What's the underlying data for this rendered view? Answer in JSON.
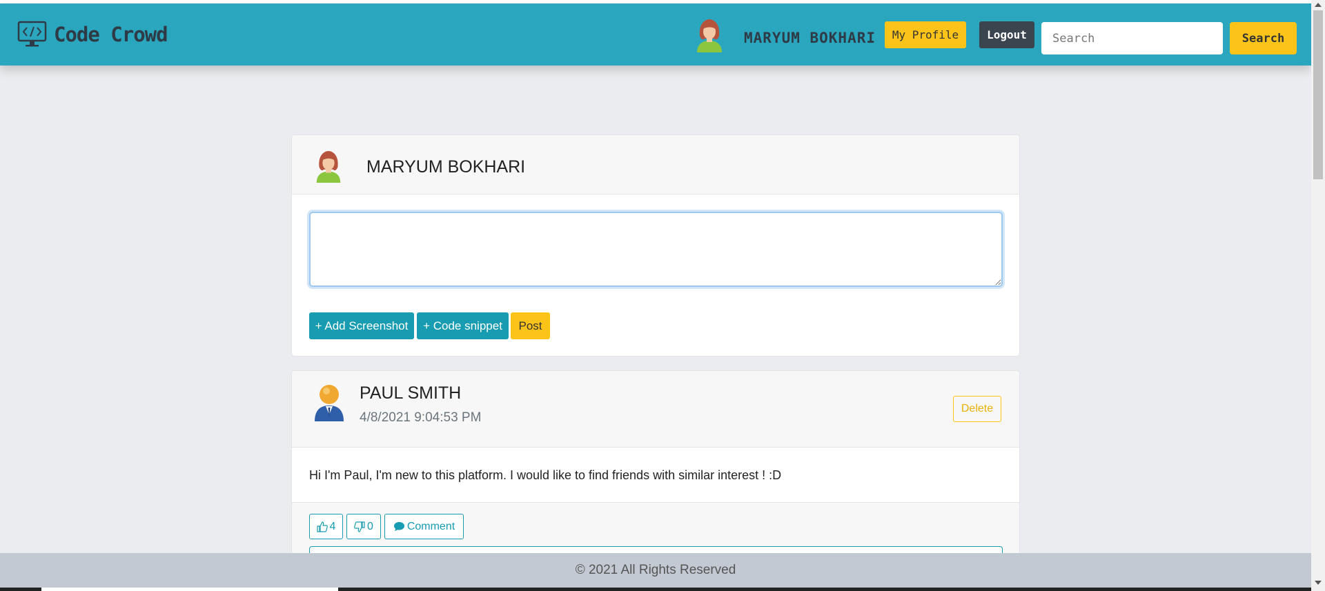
{
  "navbar": {
    "brand": "Code Crowd",
    "username": "MARYUM BOKHARI",
    "my_profile_label": "My Profile",
    "logout_label": "Logout",
    "search_placeholder": "Search",
    "search_button_label": "Search",
    "color": "#2aa7bf"
  },
  "compose": {
    "author": "MARYUM BOKHARI",
    "textarea_value": "",
    "add_screenshot_label": "+ Add Screenshot",
    "code_snippet_label": "+ Code snippet",
    "post_label": "Post"
  },
  "post": {
    "author": "PAUL SMITH",
    "timestamp": "4/8/2021 9:04:53 PM",
    "delete_label": "Delete",
    "body": "Hi I'm Paul, I'm new to this platform. I would like to find friends with similar interest ! :D",
    "likes": "4",
    "dislikes": "0",
    "comment_label": "Comment"
  },
  "footer": {
    "text": "© 2021 All Rights Reserved"
  },
  "colors": {
    "accent_teal": "#179cb2",
    "accent_yellow": "#fcc419",
    "dark": "#3b4550"
  }
}
